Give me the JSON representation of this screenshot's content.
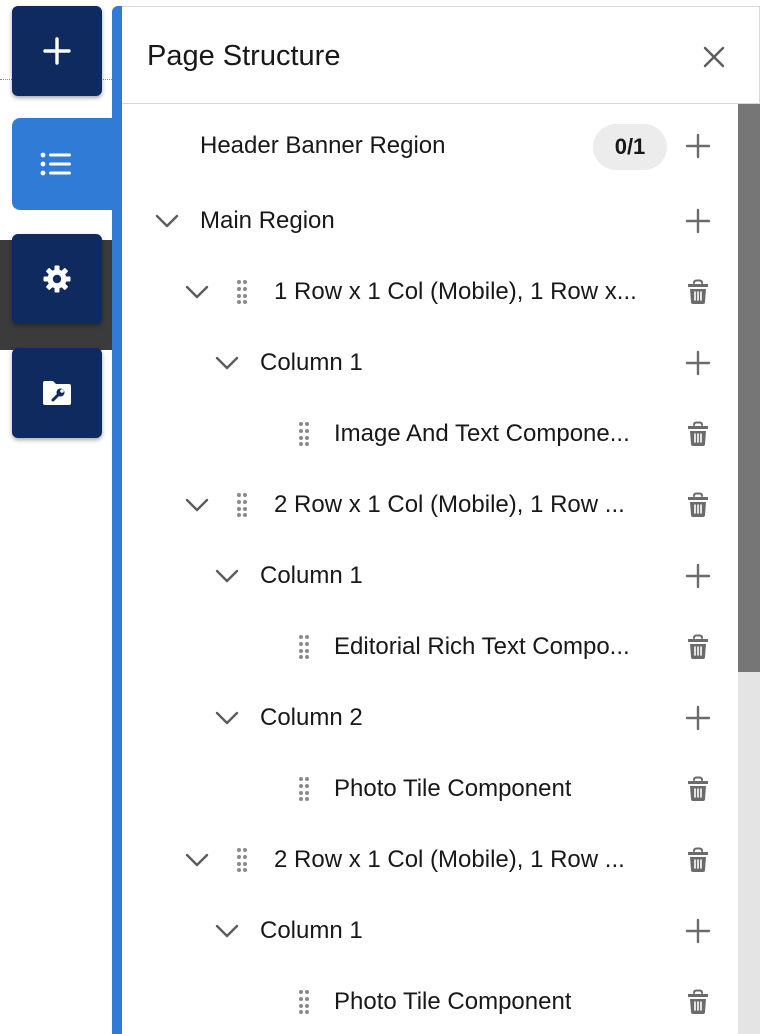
{
  "rail": {
    "buttons": [
      {
        "name": "add",
        "icon": "plus-icon"
      },
      {
        "name": "page-structure",
        "icon": "list-icon",
        "active": true
      },
      {
        "name": "settings",
        "icon": "gear-icon"
      },
      {
        "name": "site-tools",
        "icon": "folder-wrench-icon"
      }
    ],
    "colors": {
      "button": "#0f2a5f",
      "active": "#2f7bd6"
    }
  },
  "panel": {
    "title": "Page Structure",
    "close_icon": "close-icon",
    "scrollbar": {
      "position_fraction": 0.0,
      "visible_fraction": 0.61
    }
  },
  "tree": [
    {
      "label": "Header Banner Region",
      "badge": "0/1",
      "action": "add"
    },
    {
      "label": "Main Region",
      "expanded": true,
      "action": "add"
    },
    {
      "label": "1 Row x 1 Col (Mobile), 1 Row x...",
      "expanded": true,
      "draggable": true,
      "action": "delete"
    },
    {
      "label": "Column 1",
      "expanded": true,
      "action": "add"
    },
    {
      "label": "Image And Text Compone...",
      "draggable": true,
      "action": "delete"
    },
    {
      "label": "2 Row x 1 Col (Mobile), 1 Row ...",
      "expanded": true,
      "draggable": true,
      "action": "delete"
    },
    {
      "label": "Column 1",
      "expanded": true,
      "action": "add"
    },
    {
      "label": "Editorial Rich Text Compo...",
      "draggable": true,
      "action": "delete"
    },
    {
      "label": "Column 2",
      "expanded": true,
      "action": "add"
    },
    {
      "label": "Photo Tile Component",
      "draggable": true,
      "action": "delete"
    },
    {
      "label": "2 Row x 1 Col (Mobile), 1 Row ...",
      "expanded": true,
      "draggable": true,
      "action": "delete"
    },
    {
      "label": "Column 1",
      "expanded": true,
      "action": "add"
    },
    {
      "label": "Photo Tile Component",
      "draggable": true,
      "action": "delete"
    }
  ]
}
